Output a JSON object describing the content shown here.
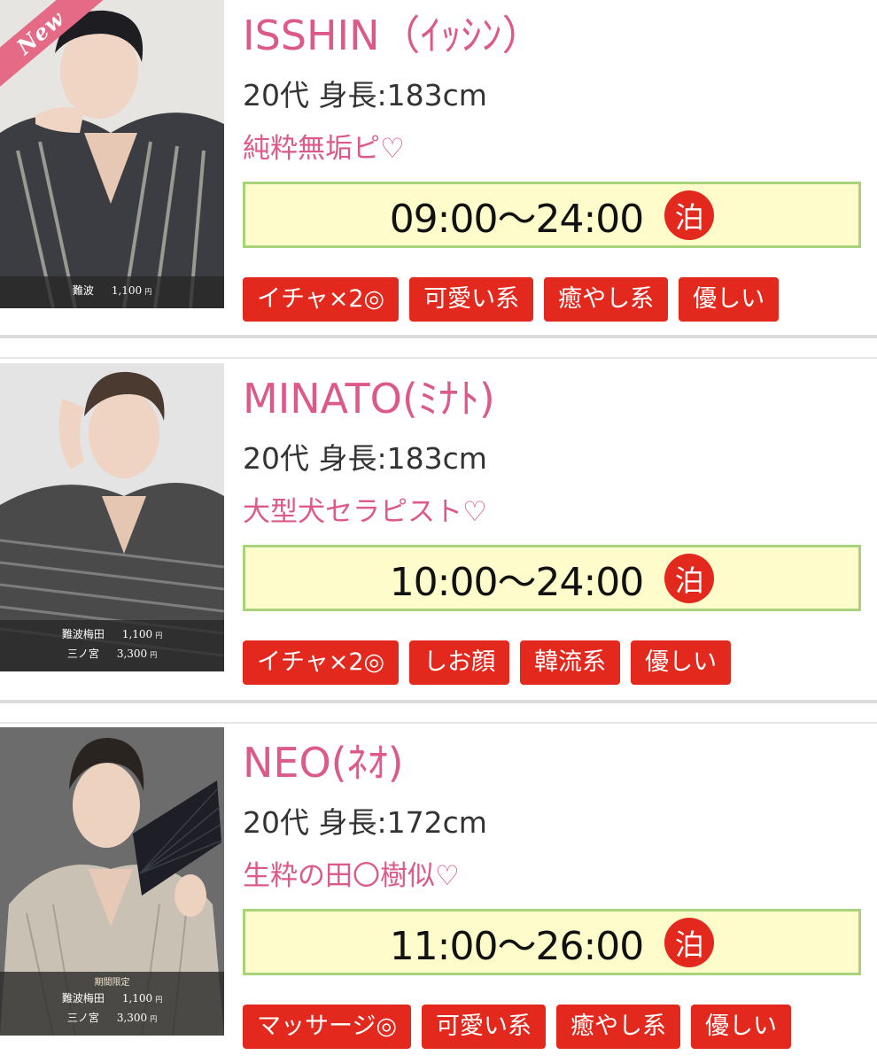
{
  "therapists": [
    {
      "name": "ISSHIN（ｲｯｼﾝ）",
      "age_height": "20代 身長:183cm",
      "catchphrase": "純粋無垢ピ♡",
      "hours": "09:00〜24:00",
      "stay_badge": "泊",
      "is_new": true,
      "new_label": "New",
      "price_heading": "",
      "prices": [
        {
          "area": "難波",
          "price": "1,100",
          "unit": "円"
        }
      ],
      "tags": [
        "イチャ×2◎",
        "可愛い系",
        "癒やし系",
        "優しい"
      ],
      "photo_colors": {
        "bg": "#e7e5e2",
        "robe": "#3b3d42",
        "stripe": "#9a9a92"
      }
    },
    {
      "name": "MINATO(ﾐﾅﾄ)",
      "age_height": "20代 身長:183cm",
      "catchphrase": "大型犬セラピスト♡",
      "hours": "10:00〜24:00",
      "stay_badge": "泊",
      "is_new": false,
      "new_label": "",
      "price_heading": "",
      "prices": [
        {
          "area": "難波梅田",
          "price": "1,100",
          "unit": "円"
        },
        {
          "area": "三ノ宮",
          "price": "3,300",
          "unit": "円"
        }
      ],
      "tags": [
        "イチャ×2◎",
        "しお顔",
        "韓流系",
        "優しい"
      ],
      "photo_colors": {
        "bg": "#e4e4e4",
        "robe": "#4a4a4a",
        "stripe": "#7d7d7d"
      }
    },
    {
      "name": "NEO(ﾈｵ)",
      "age_height": "20代 身長:172cm",
      "catchphrase": "生粋の田〇樹似♡",
      "hours": "11:00〜26:00",
      "stay_badge": "泊",
      "is_new": false,
      "new_label": "",
      "price_heading": "期間限定",
      "prices": [
        {
          "area": "難波梅田",
          "price": "1,100",
          "unit": "円"
        },
        {
          "area": "三ノ宮",
          "price": "3,300",
          "unit": "円"
        }
      ],
      "tags": [
        "マッサージ◎",
        "可愛い系",
        "癒やし系",
        "優しい"
      ],
      "photo_colors": {
        "bg": "#6c6c6c",
        "robe": "#c9c1b3",
        "stripe": "#a89f90"
      }
    }
  ],
  "colors": {
    "name_pink": "#dc5a8a",
    "tag_red": "#e3281d",
    "hours_bg": "#fffccc",
    "hours_border": "#a9d37a",
    "ribbon_pink": "#e56a86"
  }
}
